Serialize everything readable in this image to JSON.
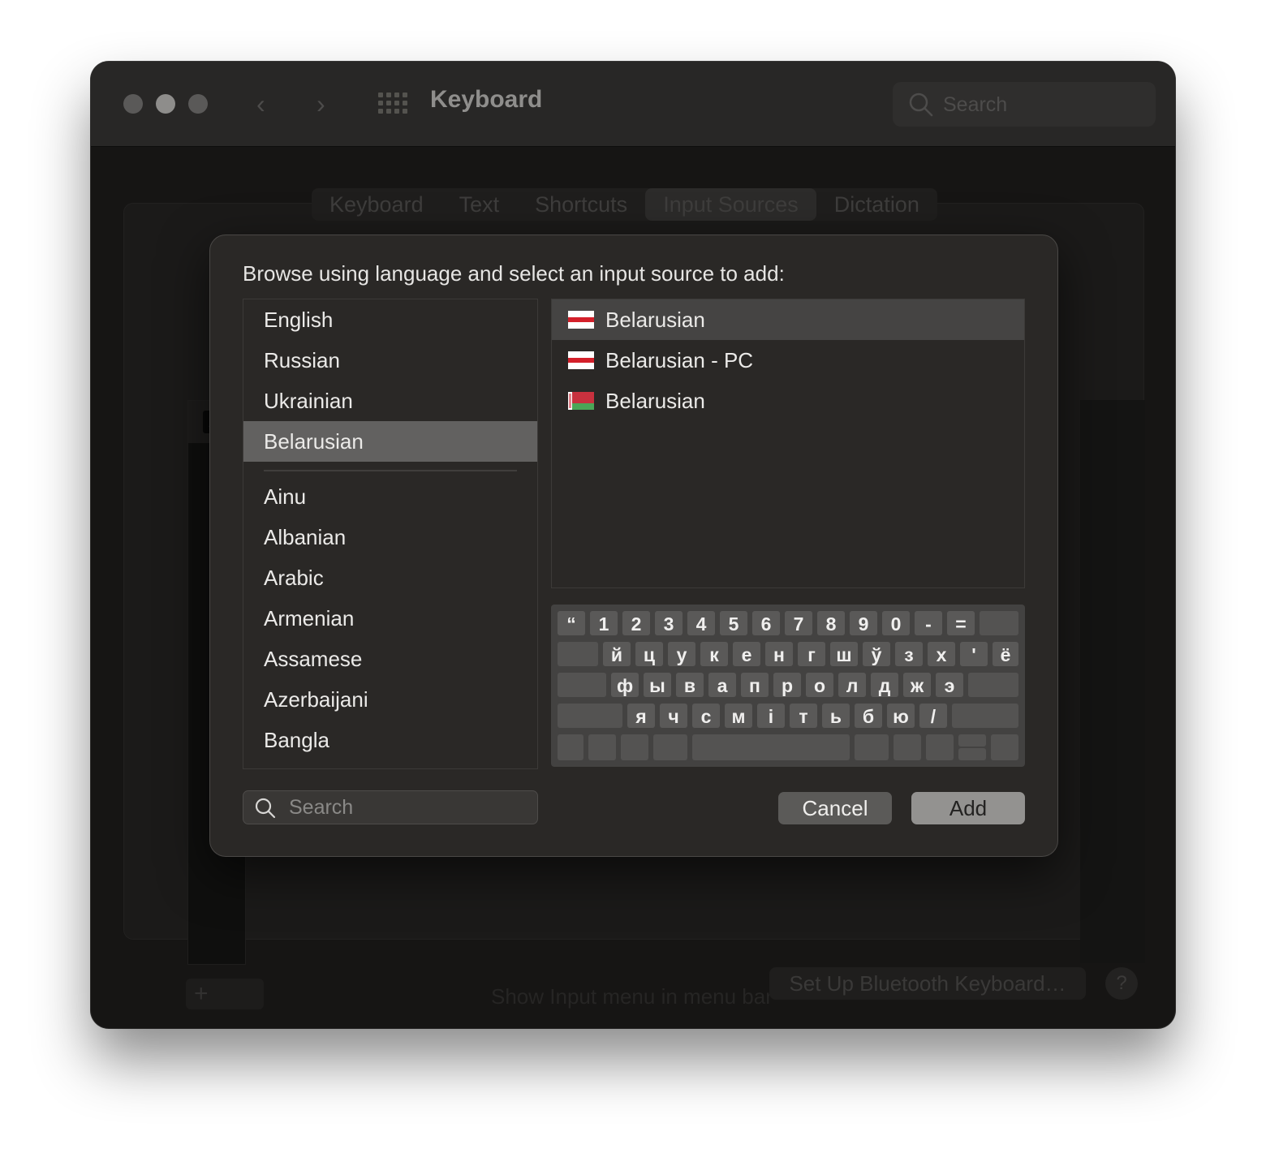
{
  "window": {
    "title": "Keyboard",
    "search_placeholder": "Search"
  },
  "tabs": [
    "Keyboard",
    "Text",
    "Shortcuts",
    "Input Sources",
    "Dictation"
  ],
  "background": {
    "show_menu_label": "Show Input menu in menu bar",
    "bluetooth_button": "Set Up Bluetooth Keyboard…",
    "help_button": "?",
    "add_button": "+",
    "list_item_icon": "A"
  },
  "dialog": {
    "prompt": "Browse using language and select an input source to add:",
    "languages_top": [
      "English",
      "Russian",
      "Ukrainian",
      "Belarusian"
    ],
    "languages_rest": [
      "Ainu",
      "Albanian",
      "Arabic",
      "Armenian",
      "Assamese",
      "Azerbaijani",
      "Bangla"
    ],
    "selected_language": "Belarusian",
    "sources": [
      {
        "label": "Belarusian",
        "flag": "white-red-white",
        "selected": true
      },
      {
        "label": "Belarusian - PC",
        "flag": "white-red-white",
        "selected": false
      },
      {
        "label": "Belarusian",
        "flag": "red-green-national",
        "selected": false
      }
    ],
    "keyboard_rows": [
      [
        "“",
        "1",
        "2",
        "3",
        "4",
        "5",
        "6",
        "7",
        "8",
        "9",
        "0",
        "-",
        "="
      ],
      [
        "й",
        "ц",
        "у",
        "к",
        "е",
        "н",
        "г",
        "ш",
        "ў",
        "з",
        "х",
        "'",
        "ё"
      ],
      [
        "ф",
        "ы",
        "в",
        "а",
        "п",
        "р",
        "о",
        "л",
        "д",
        "ж",
        "э"
      ],
      [
        "я",
        "ч",
        "с",
        "м",
        "і",
        "т",
        "ь",
        "б",
        "ю",
        "/"
      ]
    ],
    "search_placeholder": "Search",
    "cancel_label": "Cancel",
    "add_label": "Add"
  },
  "colors": {
    "window_bg": "#161514",
    "dialog_bg": "#2a2826",
    "selection": "#626160",
    "flag_red": "#d4202a",
    "flag_green": "#4aa657"
  }
}
